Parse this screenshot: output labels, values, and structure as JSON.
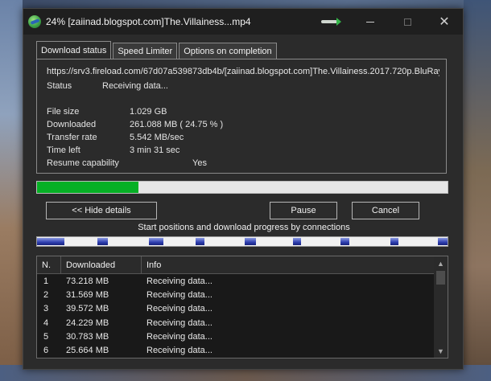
{
  "window": {
    "title": "24% [zaiinad.blogspot.com]The.Villainess...mp4",
    "close_glyph": "✕"
  },
  "tabs": [
    {
      "label": "Download status"
    },
    {
      "label": "Speed Limiter"
    },
    {
      "label": "Options on completion"
    }
  ],
  "status_panel": {
    "url": "https://srv3.fireload.com/67d07a539873db4b/[zaiinad.blogspot.com]The.Villainess.2017.720p.BluRay",
    "status_label": "Status",
    "status_value": "Receiving data...",
    "file_size_label": "File size",
    "file_size_value": "1.029  GB",
    "downloaded_label": "Downloaded",
    "downloaded_value": "261.088  MB  ( 24.75 % )",
    "transfer_rate_label": "Transfer rate",
    "transfer_rate_value": "5.542  MB/sec",
    "time_left_label": "Time left",
    "time_left_value": "3 min 31 sec",
    "resume_label": "Resume capability",
    "resume_value": "Yes"
  },
  "progress": {
    "fraction": 0.2475,
    "color": "#06b025"
  },
  "buttons": {
    "hide_details": "<< Hide details",
    "pause": "Pause",
    "cancel": "Cancel"
  },
  "connections": {
    "caption": "Start positions and download progress by connections",
    "segments": [
      {
        "start": 0.0,
        "progress": 0.066
      },
      {
        "start": 0.148,
        "progress": 0.025
      },
      {
        "start": 0.273,
        "progress": 0.035
      },
      {
        "start": 0.386,
        "progress": 0.022
      },
      {
        "start": 0.505,
        "progress": 0.027
      },
      {
        "start": 0.624,
        "progress": 0.02
      },
      {
        "start": 0.74,
        "progress": 0.022
      },
      {
        "start": 0.86,
        "progress": 0.02
      },
      {
        "start": 0.977,
        "progress": 0.023
      }
    ]
  },
  "table": {
    "headers": {
      "n": "N.",
      "downloaded": "Downloaded",
      "info": "Info"
    },
    "rows": [
      {
        "n": "1",
        "downloaded": "73.218  MB",
        "info": "Receiving data..."
      },
      {
        "n": "2",
        "downloaded": "31.569  MB",
        "info": "Receiving data..."
      },
      {
        "n": "3",
        "downloaded": "39.572  MB",
        "info": "Receiving data..."
      },
      {
        "n": "4",
        "downloaded": "24.229  MB",
        "info": "Receiving data..."
      },
      {
        "n": "5",
        "downloaded": "30.783  MB",
        "info": "Receiving data..."
      },
      {
        "n": "6",
        "downloaded": "25.664  MB",
        "info": "Receiving data..."
      }
    ]
  }
}
